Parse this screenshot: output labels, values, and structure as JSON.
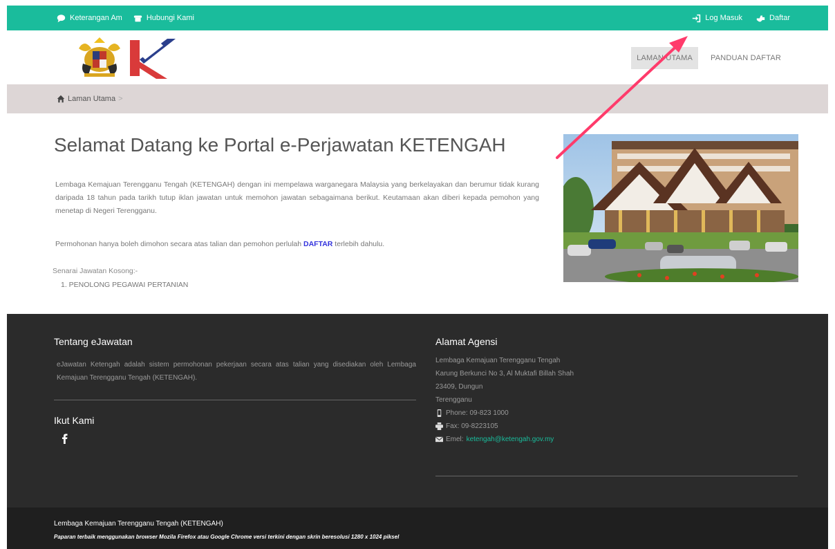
{
  "topbar": {
    "info_label": "Keterangan Am",
    "contact_label": "Hubungi Kami",
    "login_label": "Log Masuk",
    "register_label": "Daftar"
  },
  "nav": {
    "home_label": "LAMAN UTAMA",
    "guide_label": "PANDUAN DAFTAR"
  },
  "breadcrumb": {
    "home_label": "Laman Utama",
    "separator": ">"
  },
  "main": {
    "title": "Selamat Datang ke Portal e-Perjawatan KETENGAH",
    "intro": "Lembaga Kemajuan Terengganu Tengah (KETENGAH) dengan ini mempelawa warganegara Malaysia yang berkelayakan dan berumur tidak kurang daripada 18 tahun pada tarikh tutup iklan jawatan untuk memohon jawatan sebagaimana berikut. Keutamaan akan diberi kepada pemohon yang menetap di Negeri Terengganu.",
    "apply_before": "Permohonan hanya boleh dimohon secara atas talian dan pemohon perlulah ",
    "apply_link": "DAFTAR",
    "apply_after": " terlebih dahulu.",
    "vacancy_label": "Senarai Jawatan Kosong:-",
    "vacancies": [
      "1. PENOLONG PEGAWAI PERTANIAN"
    ]
  },
  "footer": {
    "about_title": "Tentang eJawatan",
    "about_text": "eJawatan Ketengah adalah sistem permohonan pekerjaan secara atas talian yang disediakan oleh Lembaga Kemajuan Terengganu Tengah (KETENGAH).",
    "follow_title": "Ikut Kami",
    "address_title": "Alamat Agensi",
    "address_lines": [
      "Lembaga Kemajuan Terengganu Tengah",
      "Karung Berkunci No 3, Al Muktafi Billah Shah",
      "23409, Dungun",
      "Terengganu"
    ],
    "phone_label": "Phone: 09-823 1000",
    "fax_label": "Fax: 09-8223105",
    "email_label": "Emel: ",
    "email_value": "ketengah@ketengah.gov.my"
  },
  "bottom": {
    "org_name": "Lembaga Kemajuan Terengganu Tengah (KETENGAH)",
    "browser_note": "Paparan terbaik menggunakan browser Mozila Firefox atau Google Chrome versi terkini dengan skrin beresolusi 1280 x 1024 piksel"
  },
  "colors": {
    "accent": "#1abc9c",
    "footer_bg": "#2b2b2b",
    "bottom_bg": "#1f1f1f",
    "annotation_arrow": "#ff3b6b"
  }
}
